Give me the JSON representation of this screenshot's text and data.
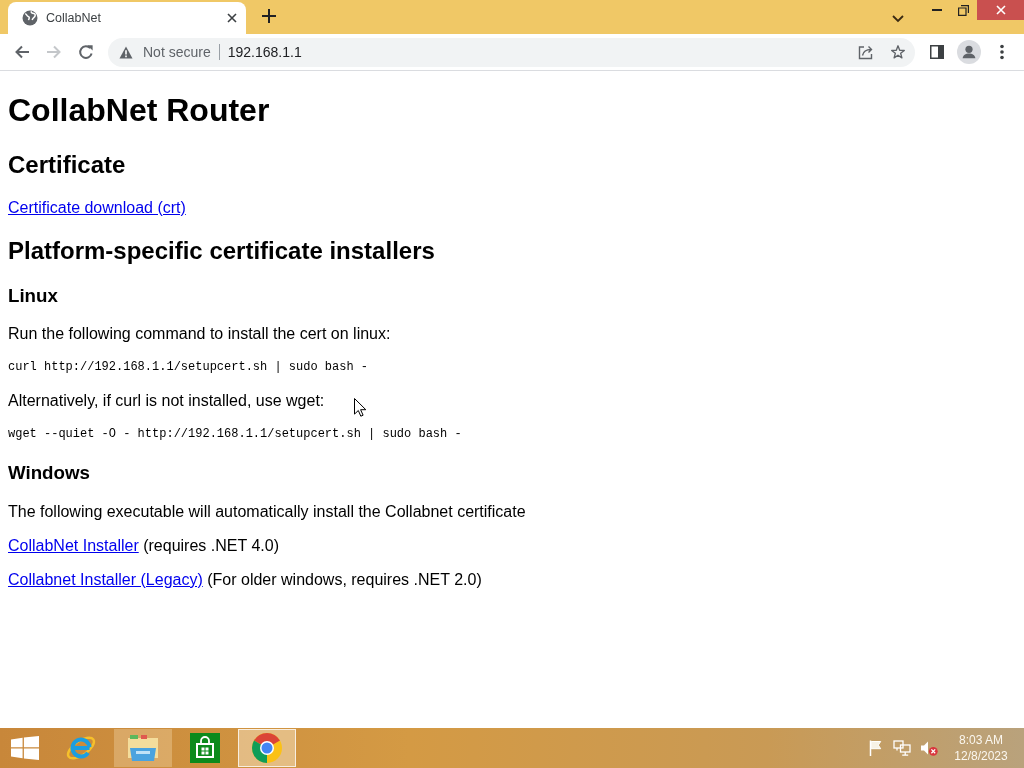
{
  "browser": {
    "tabs": [
      {
        "title": "CollabNet",
        "selected": true
      }
    ],
    "nav_buttons": [
      {
        "kind": "back",
        "disabled": false
      },
      {
        "kind": "forward",
        "disabled": true
      },
      {
        "kind": "reload",
        "disabled": false
      }
    ],
    "address_bar": {
      "security": "Not secure",
      "url": "192.168.1.1"
    }
  },
  "page": {
    "blocks": [
      {
        "kind": "h1",
        "text": "CollabNet Router"
      },
      {
        "kind": "h2",
        "text": "Certificate"
      },
      {
        "kind": "p",
        "parts": [
          {
            "kind": "link",
            "text": "Certificate download (crt)"
          }
        ]
      },
      {
        "kind": "h2",
        "text": "Platform-specific certificate installers"
      },
      {
        "kind": "h3",
        "text": "Linux"
      },
      {
        "kind": "p",
        "parts": [
          {
            "kind": "text",
            "text": "Run the following command to install the cert on linux:"
          }
        ]
      },
      {
        "kind": "code",
        "text": "curl http://192.168.1.1/setupcert.sh | sudo bash -"
      },
      {
        "kind": "p",
        "parts": [
          {
            "kind": "text",
            "text": "Alternatively, if curl is not installed, use wget:"
          }
        ]
      },
      {
        "kind": "code",
        "text": "wget --quiet -O - http://192.168.1.1/setupcert.sh | sudo bash -"
      },
      {
        "kind": "h3",
        "text": "Windows"
      },
      {
        "kind": "p",
        "parts": [
          {
            "kind": "text",
            "text": "The following executable will automatically install the Collabnet certificate"
          }
        ]
      },
      {
        "kind": "p",
        "parts": [
          {
            "kind": "link",
            "text": "CollabNet Installer"
          },
          {
            "kind": "text",
            "text": "(requires .NET 4.0)"
          }
        ]
      },
      {
        "kind": "p",
        "parts": [
          {
            "kind": "link",
            "text": "Collabnet Installer (Legacy)"
          },
          {
            "kind": "text",
            "text": "(For older windows, requires .NET 2.0)"
          }
        ]
      }
    ]
  },
  "taskbar": {
    "apps": [
      {
        "kind": "ie",
        "running": false,
        "selected": false
      },
      {
        "kind": "explorer",
        "running": true,
        "selected": false
      },
      {
        "kind": "store",
        "running": false,
        "selected": false
      },
      {
        "kind": "chrome",
        "running": true,
        "selected": true
      }
    ],
    "tray": {
      "volume_muted": true
    },
    "clock": {
      "time": "8:03 AM",
      "date": "12/8/2023"
    }
  }
}
